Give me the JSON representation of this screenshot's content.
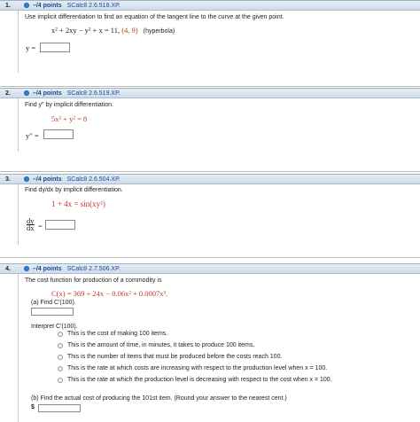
{
  "questions": [
    {
      "number": "1.",
      "points": "–/4 points",
      "source": "SCalc8 2.6.518.XP.",
      "prompt": "Use implicit differentiation to find an equation of the tangent line to the curve at the given point.",
      "equation_lhs": "x² + 2xy − y² + x = 11,",
      "equation_point": "(4, 9)",
      "equation_note": "(hyperbola)",
      "answer_label": "y ="
    },
    {
      "number": "2.",
      "points": "–/4 points",
      "source": "SCalc8 2.6.519.XP.",
      "prompt": "Find y″ by implicit differentiation.",
      "equation": "5x² + y² = 8",
      "answer_label": "y″ ="
    },
    {
      "number": "3.",
      "points": "–/4 points",
      "source": "SCalc8 2.6.504.XP.",
      "prompt": "Find dy/dx by implicit differentiation.",
      "equation": "1 + 4x = sin(xy²)",
      "answer_label_num": "dy",
      "answer_label_den": "dx",
      "answer_label_eq": "="
    },
    {
      "number": "4.",
      "points": "–/4 points",
      "source": "SCalc8 2.7.506.XP.",
      "prompt": "The cost function for production of a commodity is",
      "equation": "C(x) = 369 + 24x − 0.06x² + 0.0007x³.",
      "part_a": "(a) Find C′(100).",
      "interpret": "Interpret C′(100).",
      "options": [
        "This is the cost of making 100 items.",
        "This is the amount of time, in minutes, it takes to produce 100 items.",
        "This is the number of items that must be produced before the costs reach 100.",
        "This is the rate at which costs are increasing with respect to the production level when x = 100.",
        "This is the rate at which the production level is decreasing with respect to the cost when x = 100."
      ],
      "part_b": "(b) Find the actual cost of producing the 101st item. (Round your answer to the nearest cent.)",
      "currency": "$"
    }
  ]
}
